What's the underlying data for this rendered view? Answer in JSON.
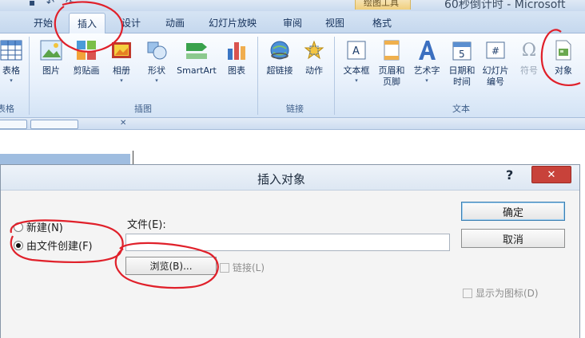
{
  "window": {
    "title_fragment": "60秒倒计时 - Microsoft",
    "context_tab_label": "绘图工具"
  },
  "ribbon": {
    "tabs": [
      {
        "label": "开始",
        "active": false
      },
      {
        "label": "插入",
        "active": true
      },
      {
        "label": "设计",
        "active": false
      },
      {
        "label": "动画",
        "active": false
      },
      {
        "label": "幻灯片放映",
        "active": false
      },
      {
        "label": "审阅",
        "active": false
      },
      {
        "label": "视图",
        "active": false
      },
      {
        "label": "格式",
        "active": false
      }
    ],
    "groups": {
      "tables": {
        "label": "表格",
        "buttons": [
          {
            "label": "表格",
            "icon": "table-icon"
          }
        ]
      },
      "illustrations": {
        "label": "插图",
        "buttons": [
          {
            "label": "图片",
            "icon": "picture-icon"
          },
          {
            "label": "剪贴画",
            "icon": "clipart-icon"
          },
          {
            "label": "相册",
            "icon": "photo-album-icon"
          },
          {
            "label": "形状",
            "icon": "shapes-icon"
          },
          {
            "label": "SmartArt",
            "icon": "smartart-icon"
          },
          {
            "label": "图表",
            "icon": "chart-icon"
          }
        ]
      },
      "links": {
        "label": "链接",
        "buttons": [
          {
            "label": "超链接",
            "icon": "hyperlink-icon"
          },
          {
            "label": "动作",
            "icon": "action-icon"
          }
        ]
      },
      "text": {
        "label": "文本",
        "buttons": [
          {
            "label": "文本框",
            "icon": "textbox-icon"
          },
          {
            "label": "页眉和",
            "label2": "页脚",
            "icon": "header-footer-icon"
          },
          {
            "label": "艺术字",
            "icon": "wordart-icon"
          },
          {
            "label": "日期和",
            "label2": "时间",
            "icon": "date-time-icon"
          },
          {
            "label": "幻灯片",
            "label2": "编号",
            "icon": "slide-number-icon"
          },
          {
            "label": "符号",
            "icon": "symbol-icon",
            "disabled": true
          },
          {
            "label": "对象",
            "icon": "object-icon"
          }
        ]
      }
    }
  },
  "dialog": {
    "title": "插入对象",
    "help": "?",
    "close": "✕",
    "options": [
      {
        "label": "新建(N)",
        "selected": false
      },
      {
        "label": "由文件创建(F)",
        "selected": true
      }
    ],
    "file_label": "文件(E):",
    "file_value": "",
    "browse_label": "浏览(B)...",
    "link_label": "链接(L)",
    "ok_label": "确定",
    "cancel_label": "取消",
    "display_as_icon_label": "显示为图标(D)"
  },
  "colors": {
    "annotation_red": "#e0202a",
    "ribbon_blue": "#c5d8ee",
    "close_red": "#c8423a"
  }
}
